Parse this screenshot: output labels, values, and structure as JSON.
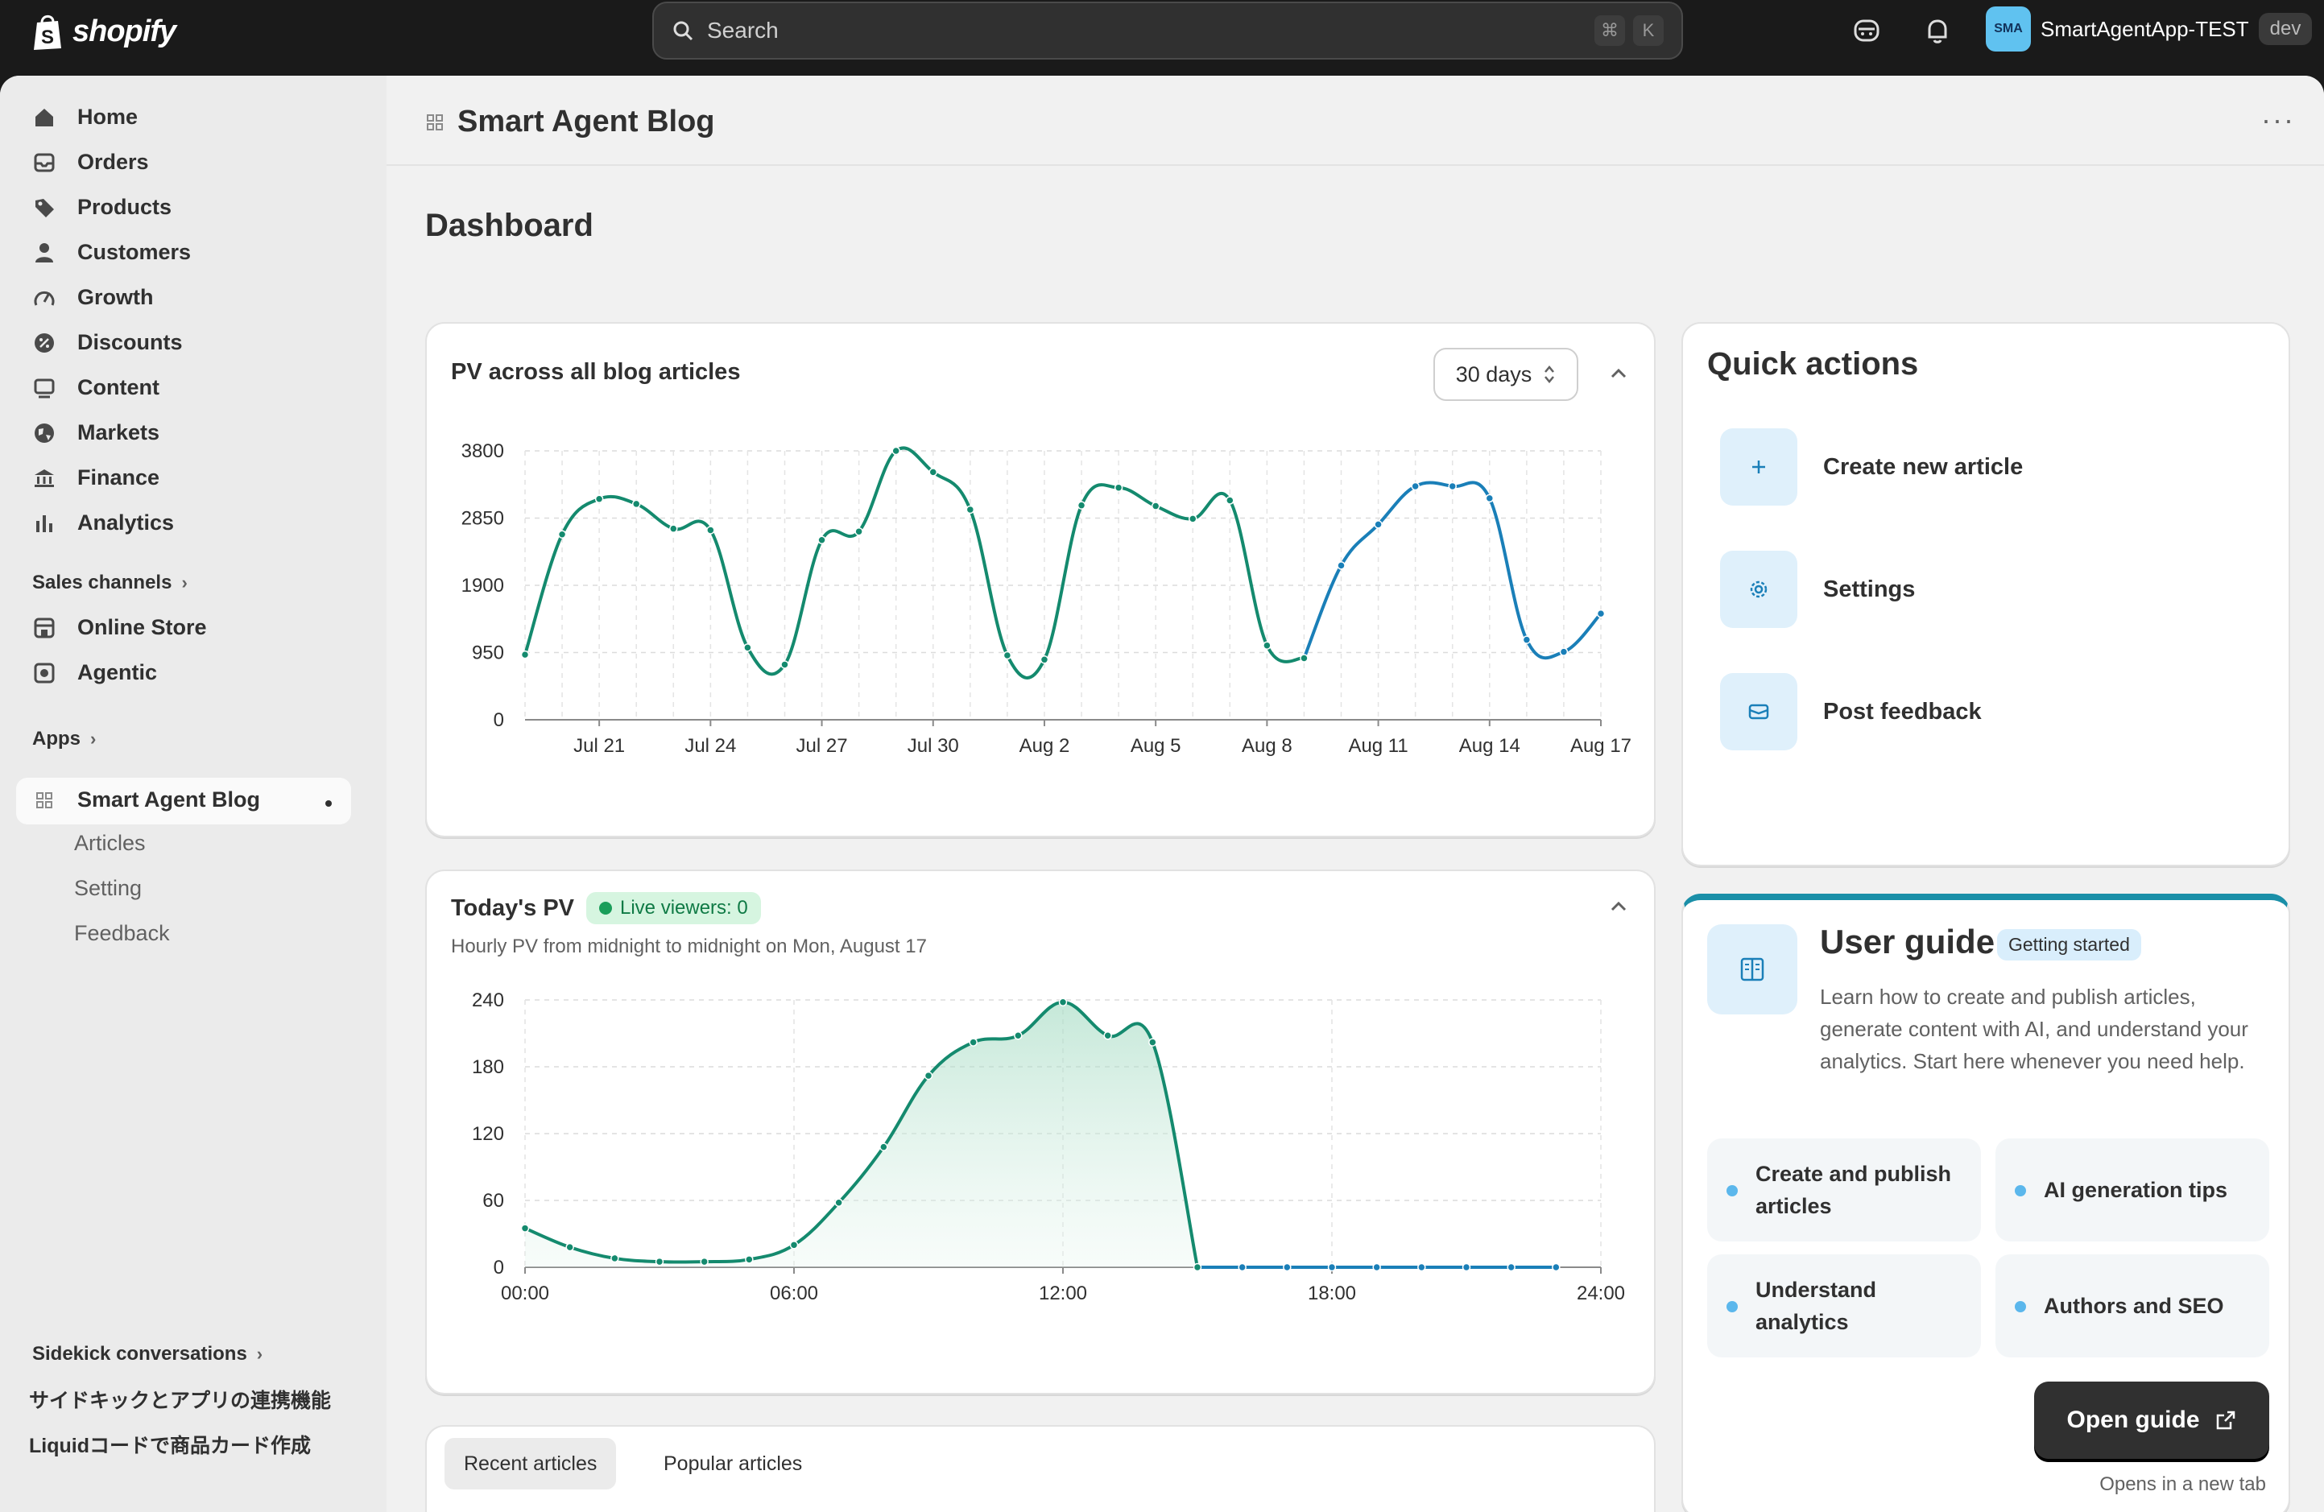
{
  "topbar": {
    "logo_text": "shopify",
    "search_placeholder": "Search",
    "shortcut_cmd": "⌘",
    "shortcut_key": "K",
    "store_avatar": "SMA",
    "store_name": "SmartAgentApp-TEST",
    "env_badge": "dev"
  },
  "sidebar": {
    "items": [
      {
        "label": "Home",
        "icon": "home-icon"
      },
      {
        "label": "Orders",
        "icon": "orders-icon"
      },
      {
        "label": "Products",
        "icon": "tag-icon"
      },
      {
        "label": "Customers",
        "icon": "person-icon"
      },
      {
        "label": "Growth",
        "icon": "gauge-icon"
      },
      {
        "label": "Discounts",
        "icon": "discount-icon"
      },
      {
        "label": "Content",
        "icon": "content-icon"
      },
      {
        "label": "Markets",
        "icon": "globe-icon"
      },
      {
        "label": "Finance",
        "icon": "bank-icon"
      },
      {
        "label": "Analytics",
        "icon": "bar-chart-icon"
      }
    ],
    "sales_channels_label": "Sales channels",
    "channels": [
      {
        "label": "Online Store",
        "icon": "store-icon"
      },
      {
        "label": "Agentic",
        "icon": "agentic-icon"
      }
    ],
    "apps_label": "Apps",
    "app_name": "Smart Agent Blog",
    "app_subitems": [
      "Articles",
      "Setting",
      "Feedback"
    ],
    "sidekick_label": "Sidekick conversations",
    "sidekick_items": [
      "サイドキックとアプリの連携機能",
      "Liquidコードで商品カード作成"
    ]
  },
  "header": {
    "title": "Smart Agent Blog",
    "more": "···"
  },
  "dashboard_title": "Dashboard",
  "pv_card": {
    "title": "PV across all blog articles",
    "range_select": "30 days"
  },
  "today_card": {
    "title": "Today's PV",
    "live_badge": "Live viewers: 0",
    "subtitle": "Hourly PV from midnight to midnight on Mon, August 17"
  },
  "articles_card": {
    "tabs": [
      "Recent articles",
      "Popular articles"
    ]
  },
  "quick_actions": {
    "title": "Quick actions",
    "items": [
      {
        "label": "Create new article",
        "icon": "plus-icon"
      },
      {
        "label": "Settings",
        "icon": "gear-icon"
      },
      {
        "label": "Post feedback",
        "icon": "mail-icon"
      }
    ]
  },
  "user_guide": {
    "title": "User guide",
    "badge": "Getting started",
    "description": "Learn how to create and publish articles, generate content with AI, and understand your analytics. Start here whenever you need help.",
    "tiles": [
      "Create and publish articles",
      "AI generation tips",
      "Understand analytics",
      "Authors and SEO"
    ],
    "button": "Open guide",
    "note": "Opens in a new tab"
  },
  "colors": {
    "accent_green": "#148a6e",
    "accent_blue": "#1a7fb8",
    "topbar": "#1a1a1a"
  },
  "chart_data": [
    {
      "type": "line",
      "title": "PV across all blog articles",
      "x_ticks": [
        "Jul 21",
        "Jul 24",
        "Jul 27",
        "Jul 30",
        "Aug 2",
        "Aug 5",
        "Aug 8",
        "Aug 11",
        "Aug 14",
        "Aug 17"
      ],
      "y_ticks": [
        0,
        950,
        1900,
        2850,
        3800
      ],
      "ylim": [
        0,
        3800
      ],
      "x": [
        "Jul 19",
        "Jul 20",
        "Jul 21",
        "Jul 22",
        "Jul 23",
        "Jul 24",
        "Jul 25",
        "Jul 26",
        "Jul 27",
        "Jul 28",
        "Jul 29",
        "Jul 30",
        "Jul 31",
        "Aug 1",
        "Aug 2",
        "Aug 3",
        "Aug 4",
        "Aug 5",
        "Aug 6",
        "Aug 7",
        "Aug 8",
        "Aug 9",
        "Aug 10",
        "Aug 11",
        "Aug 12",
        "Aug 13",
        "Aug 14",
        "Aug 15",
        "Aug 16",
        "Aug 17"
      ],
      "values": [
        920,
        2620,
        3120,
        3050,
        2700,
        2680,
        1020,
        780,
        2540,
        2660,
        3800,
        3500,
        2970,
        910,
        850,
        3030,
        3280,
        3020,
        2840,
        3100,
        1050,
        870,
        2180,
        2760,
        3300,
        3300,
        3130,
        1130,
        960,
        1500
      ],
      "grid": true
    },
    {
      "type": "area",
      "title": "Today's PV",
      "x_ticks": [
        "00:00",
        "06:00",
        "12:00",
        "18:00",
        "24:00"
      ],
      "y_ticks": [
        0,
        60,
        120,
        180,
        240
      ],
      "ylim": [
        0,
        240
      ],
      "x": [
        0,
        1,
        2,
        3,
        4,
        5,
        6,
        7,
        8,
        9,
        10,
        11,
        12,
        13,
        14,
        15,
        16,
        17,
        18,
        19,
        20,
        21,
        22,
        23
      ],
      "values": [
        35,
        18,
        8,
        5,
        5,
        7,
        20,
        58,
        108,
        172,
        202,
        208,
        238,
        208,
        202,
        0,
        0,
        0,
        0,
        0,
        0,
        0,
        0,
        0
      ],
      "grid": true
    }
  ]
}
